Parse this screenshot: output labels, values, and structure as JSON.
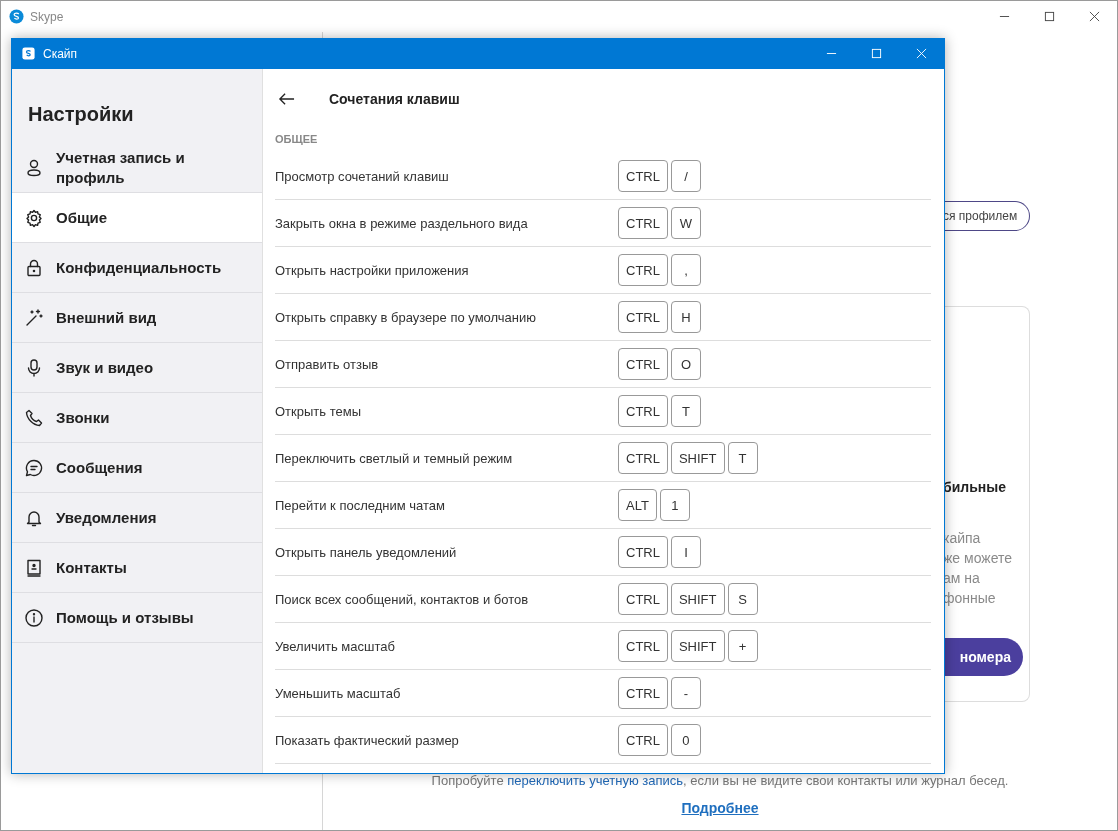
{
  "background_window": {
    "title": "Skype",
    "profile_button": "ся профилем",
    "card": {
      "heading": "бильные",
      "text_lines": [
        "кайпа",
        "же можете",
        "ам на",
        "фонные"
      ],
      "button": "номера"
    },
    "footer": {
      "text_before": "Попробуйте ",
      "link": "переключить учетную запись",
      "text_after": ", если вы не видите свои контакты или журнал бесед.",
      "more_link": "Подробнее"
    }
  },
  "dialog": {
    "title": "Скайп",
    "sidebar": {
      "heading": "Настройки",
      "items": [
        {
          "label": "Учетная запись и профиль",
          "selected": false
        },
        {
          "label": "Общие",
          "selected": true
        },
        {
          "label": "Конфиденциальность",
          "selected": false
        },
        {
          "label": "Внешний вид",
          "selected": false
        },
        {
          "label": "Звук и видео",
          "selected": false
        },
        {
          "label": "Звонки",
          "selected": false
        },
        {
          "label": "Сообщения",
          "selected": false
        },
        {
          "label": "Уведомления",
          "selected": false
        },
        {
          "label": "Контакты",
          "selected": false
        },
        {
          "label": "Помощь и отзывы",
          "selected": false
        }
      ]
    },
    "page": {
      "title": "Сочетания клавиш",
      "section": "ОБЩЕЕ",
      "shortcuts": [
        {
          "action": "Просмотр сочетаний клавиш",
          "keys": [
            "CTRL",
            "/"
          ]
        },
        {
          "action": "Закрыть окна в режиме раздельного вида",
          "keys": [
            "CTRL",
            "W"
          ]
        },
        {
          "action": "Открыть настройки приложения",
          "keys": [
            "CTRL",
            ","
          ]
        },
        {
          "action": "Открыть справку в браузере по умолчанию",
          "keys": [
            "CTRL",
            "H"
          ]
        },
        {
          "action": "Отправить отзыв",
          "keys": [
            "CTRL",
            "O"
          ]
        },
        {
          "action": "Открыть темы",
          "keys": [
            "CTRL",
            "T"
          ]
        },
        {
          "action": "Переключить светлый и темный режим",
          "keys": [
            "CTRL",
            "SHIFT",
            "T"
          ]
        },
        {
          "action": "Перейти к последним чатам",
          "keys": [
            "ALT",
            "1"
          ]
        },
        {
          "action": "Открыть панель уведомлений",
          "keys": [
            "CTRL",
            "I"
          ]
        },
        {
          "action": "Поиск всех сообщений, контактов и ботов",
          "keys": [
            "CTRL",
            "SHIFT",
            "S"
          ]
        },
        {
          "action": "Увеличить масштаб",
          "keys": [
            "CTRL",
            "SHIFT",
            "+"
          ]
        },
        {
          "action": "Уменьшить масштаб",
          "keys": [
            "CTRL",
            "-"
          ]
        },
        {
          "action": "Показать фактический размер",
          "keys": [
            "CTRL",
            "0"
          ]
        }
      ]
    }
  }
}
